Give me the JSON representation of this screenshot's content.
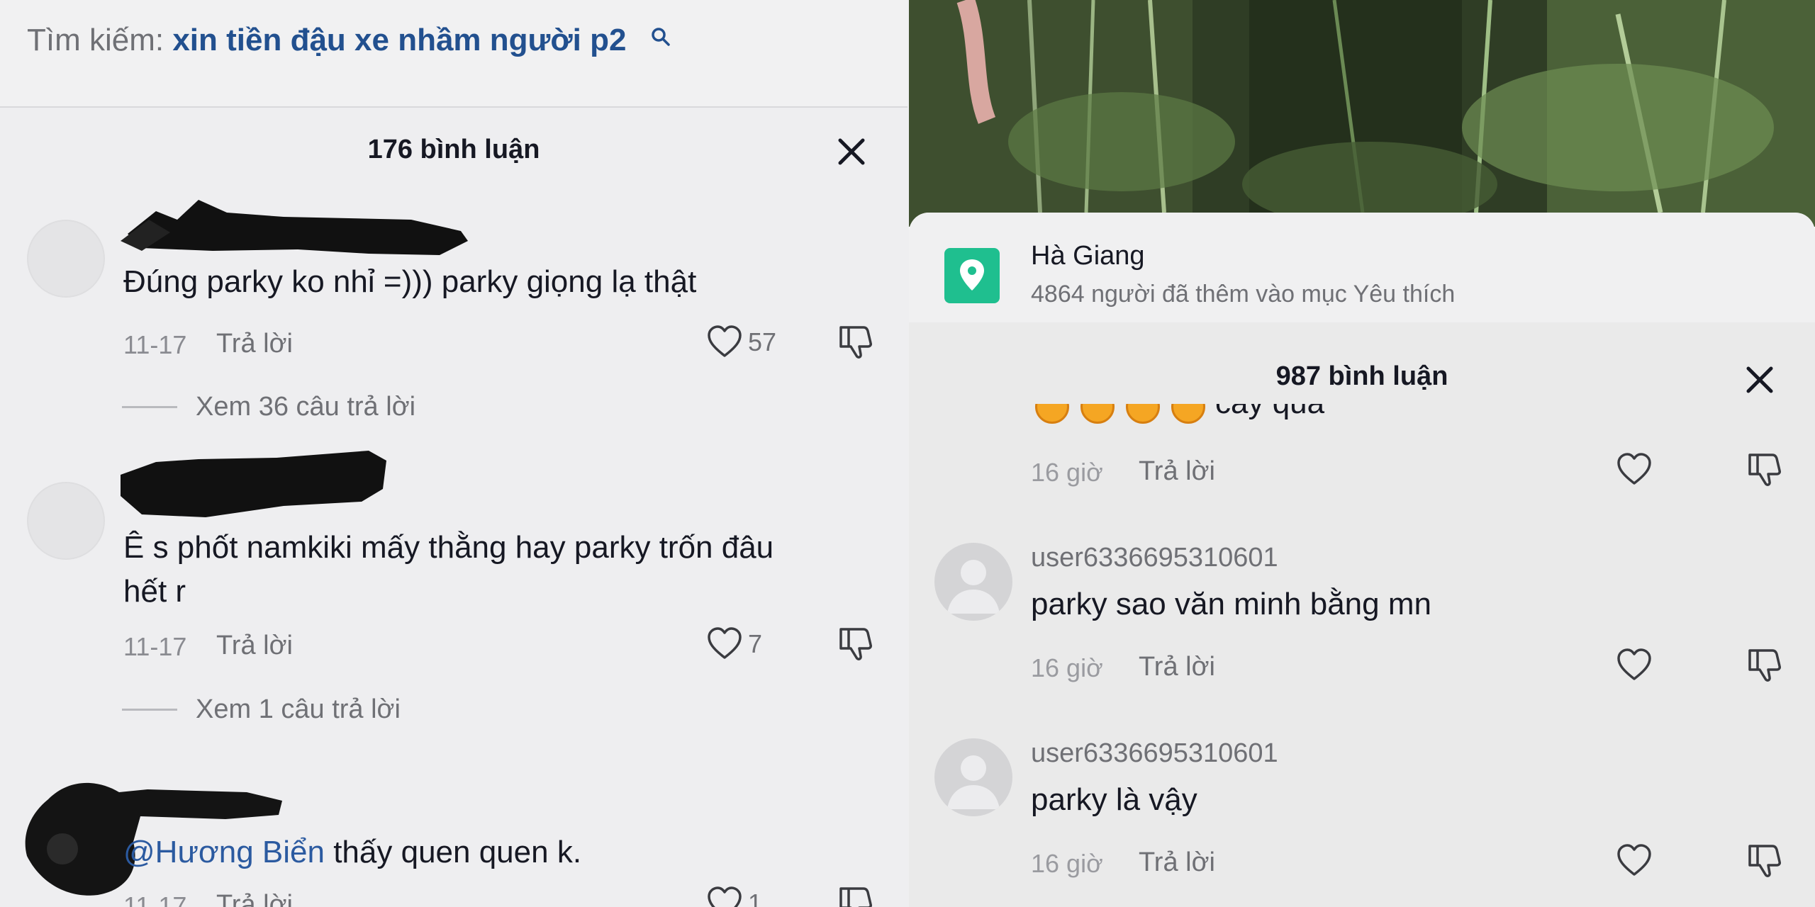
{
  "left": {
    "search": {
      "label": "Tìm kiếm: ",
      "query": "xin tiền đậu xe nhầm người p2",
      "icon": "search-icon"
    },
    "header": {
      "count_label": "176 bình luận",
      "close_icon": "close-icon"
    },
    "comments": [
      {
        "text": "Đúng parky ko nhỉ =))) parky giọng lạ thật",
        "date": "11-17",
        "reply_label": "Trả lời",
        "likes": "57",
        "view_replies": "Xem 36 câu trả lời"
      },
      {
        "text_line1": "Ê s phốt namkiki mấy thằng hay parky trốn đâu",
        "text_line2": "hết r",
        "date": "11-17",
        "reply_label": "Trả lời",
        "likes": "7",
        "view_replies": "Xem 1 câu trả lời"
      },
      {
        "mention": "@Hương Biển",
        "text": " thấy quen quen k.",
        "date": "11-17",
        "reply_label": "Trả lời",
        "likes": "1"
      }
    ]
  },
  "right": {
    "location": {
      "name": "Hà Giang",
      "subtitle": "4864 người đã thêm vào mục Yêu thích",
      "icon": "map-pin-icon"
    },
    "header": {
      "count_label": "987 bình luận",
      "close_icon": "close-icon"
    },
    "comments": [
      {
        "text_partial": "cay quá",
        "time": "16 giờ",
        "reply_label": "Trả lời"
      },
      {
        "user": "user6336695310601",
        "text": "parky sao văn minh bằng mn",
        "time": "16 giờ",
        "reply_label": "Trả lời"
      },
      {
        "user": "user6336695310601",
        "text": "parky là vậy",
        "time": "16 giờ",
        "reply_label": "Trả lời"
      }
    ]
  },
  "colors": {
    "mention_blue": "#2b5aa0",
    "search_query_blue": "#22508f",
    "location_green": "#1fbf8f"
  }
}
